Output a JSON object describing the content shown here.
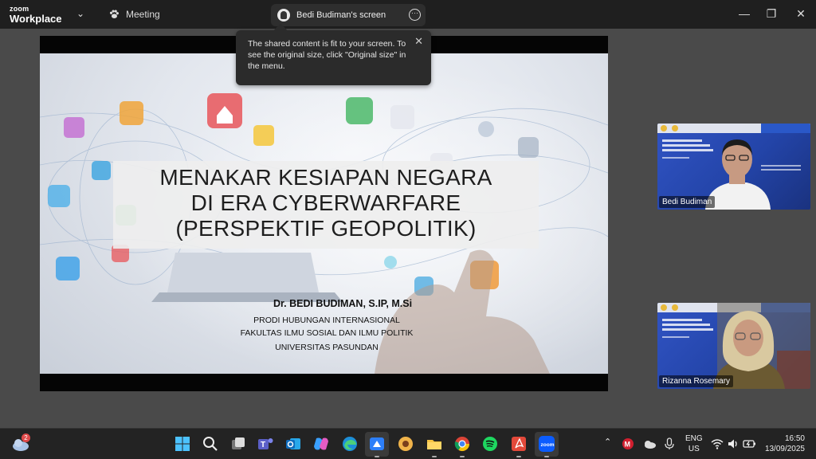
{
  "titlebar": {
    "brand_top": "zoom",
    "brand_bottom": "Workplace",
    "meeting_label": "Meeting",
    "share_pill_label": "Bedi Budiman's screen",
    "minimize": "—",
    "restore": "❐",
    "close": "✕"
  },
  "tooltip": {
    "text": "The shared content is fit to your screen. To see the original size, click \"Original size\" in the menu."
  },
  "slide": {
    "title_lines": [
      "MENAKAR KESIAPAN NEGARA",
      "DI ERA CYBERWARFARE",
      "(PERSPEKTIF GEOPOLITIK)"
    ],
    "author_name": "Dr. BEDI BUDIMAN, S.IP, M.Si",
    "affiliation_lines": [
      "PRODI HUBUNGAN INTERNASIONAL",
      "FAKULTAS ILMU SOSIAL DAN ILMU POLITIK",
      "UNIVERSITAS PASUNDAN"
    ]
  },
  "participants": [
    {
      "name": "Bedi Budiman"
    },
    {
      "name": "Rizanna Rosemary"
    }
  ],
  "taskbar": {
    "notification_count": "2",
    "language_top": "ENG",
    "language_bottom": "US",
    "time": "16:50",
    "date": "13/09/2025",
    "apps": [
      "windows-start",
      "search",
      "task-view",
      "teams",
      "outlook",
      "copilot",
      "edge",
      "zoom-workplace-alt",
      "files-app",
      "file-explorer",
      "chrome",
      "spotify",
      "acrobat",
      "zoom"
    ]
  },
  "colors": {
    "titlebar_bg": "#1f1f1f",
    "app_bg": "#4a4a4a",
    "taskbar_bg": "#232323",
    "tile_blue": "#2e4aa8"
  }
}
